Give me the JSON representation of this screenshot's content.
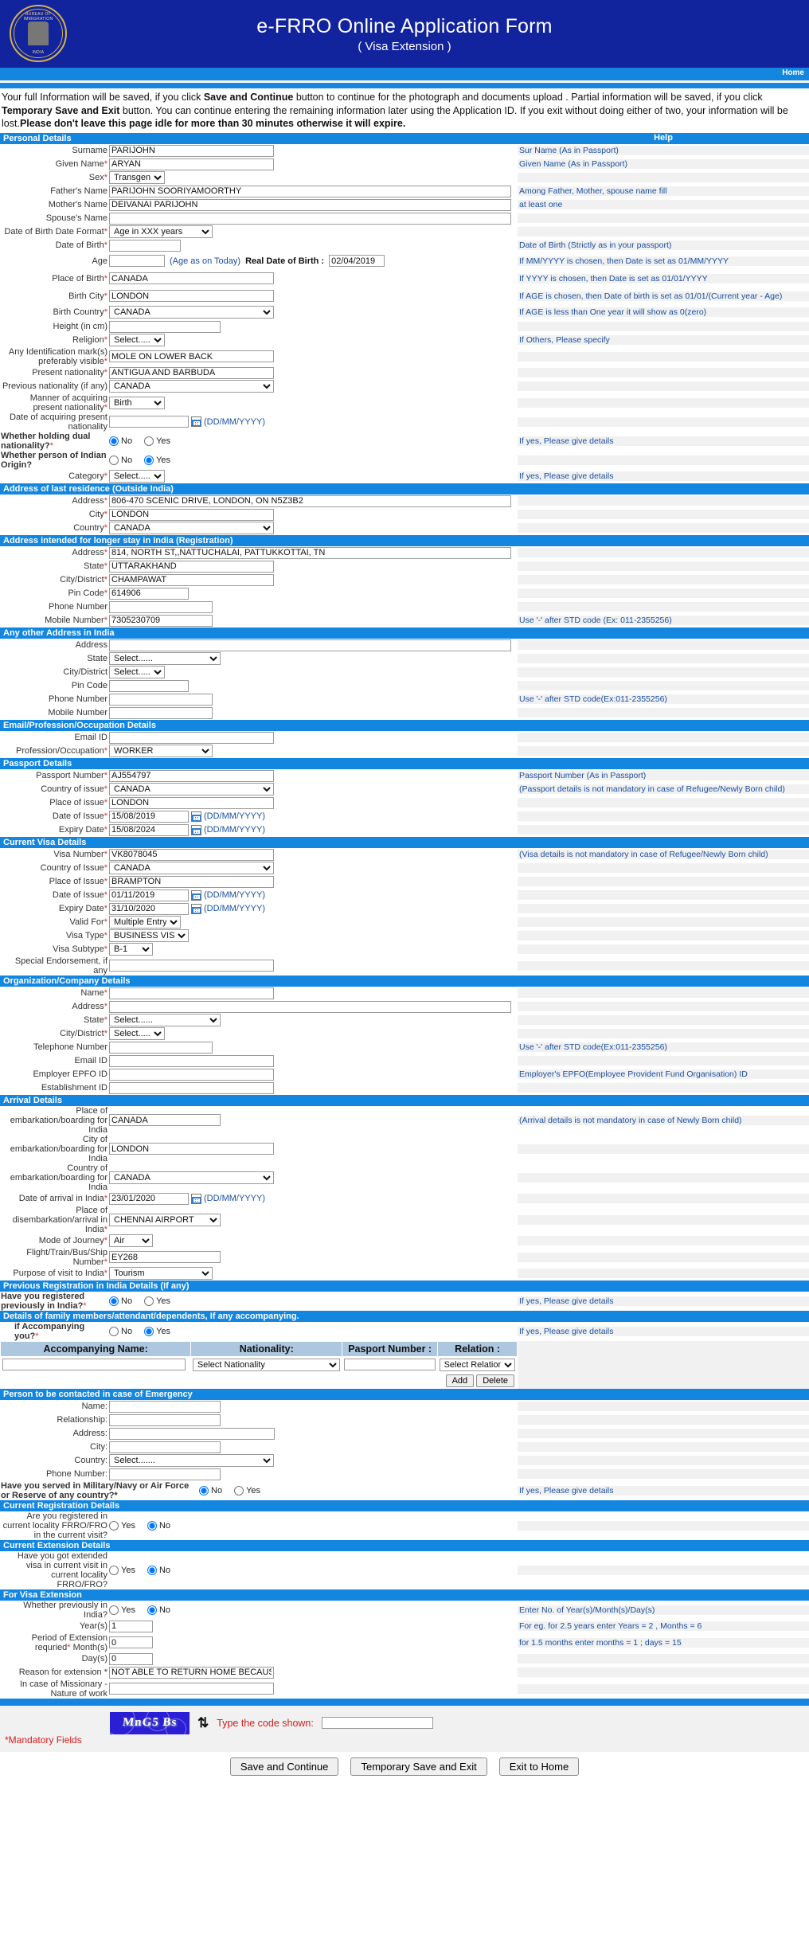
{
  "header": {
    "title": "e-FRRO Online Application Form",
    "subtitle": "( Visa Extension )",
    "emblem_top": "BUREAU OF IMMIGRATION",
    "emblem_bottom": "INDIA",
    "home_link": "Home"
  },
  "notice": {
    "p1": "Your full Information will be saved, if you click ",
    "b1": "Save and Continue",
    "p2": " button to continue for the photograph and documents upload . Partial information will be saved, if you click ",
    "b2": "Temporary Save and Exit",
    "p3": " button. You can continue entering the remaining information later using the Application ID. If you exit without doing either of two, your information will be lost.",
    "b3": "Please don't leave this page idle for more than 30 minutes otherwise it will expire."
  },
  "help_column_title": "Help",
  "sections": {
    "personal": "Personal Details",
    "last_residence": "Address of last residence (Outside India)",
    "longer_stay": "Address intended for longer stay in India (Registration)",
    "any_other": "Any other Address in India",
    "email_prof": "Email/Profession/Occupation Details",
    "passport": "Passport Details",
    "current_visa": "Current Visa Details",
    "organization": "Organization/Company Details",
    "arrival": "Arrival Details",
    "prev_registration": "Previous Registration in India Details (If any)",
    "family_details": "Details of family members/attendant/dependents, If any accompanying.",
    "emergency": "Person to be contacted in case of Emergency",
    "current_registration": "Current Registration Details",
    "current_extension": "Current Extension Details",
    "for_visa_extension": "For Visa Extension"
  },
  "personal": {
    "surname_label": "Surname",
    "surname_value": "PARIJOHN",
    "surname_help": "Sur Name (As in Passport)",
    "given_name_label": "Given Name",
    "given_name_value": "ARYAN",
    "given_name_help": "Given Name (As in Passport)",
    "sex_label": "Sex",
    "sex_value": "Transgender",
    "father_label": "Father's Name",
    "father_value": "PARIJOHN SOORIYAMOORTHY",
    "father_help": "Among Father, Mother, spouse name fill",
    "mother_label": "Mother's Name",
    "mother_value": "DEIVANAI PARIJOHN",
    "mother_help": "at least one",
    "spouse_label": "Spouse's Name",
    "spouse_value": "",
    "dob_format_label": "Date of Birth Date Format",
    "dob_format_value": "Age in XXX years",
    "dob_label": "Date of Birth",
    "dob_value": "",
    "dob_help": "Date of Birth (Strictly as in your passport)",
    "age_label": "Age",
    "age_value": "",
    "age_note": "(Age as on Today)",
    "real_dob_label": "Real Date of Birth :",
    "real_dob_value": "02/04/2019",
    "dob_help2": "If MM/YYYY is chosen, then Date is set as 01/MM/YYYY",
    "dob_help3": "If YYYY is chosen, then Date is set as 01/01/YYYY",
    "dob_help4": "If AGE is chosen, then Date of birth is set as 01/01/(Current year - Age)",
    "dob_help5": "If AGE is less than One year it will show as 0(zero)",
    "place_birth_label": "Place of Birth",
    "place_birth_value": "CANADA",
    "birth_city_label": "Birth City",
    "birth_city_value": "LONDON",
    "birth_country_label": "Birth Country",
    "birth_country_value": "CANADA",
    "height_label": "Height (in cm)",
    "height_value": "",
    "religion_label": "Religion",
    "religion_value": "Select......",
    "religion_help": "If Others, Please specify",
    "id_mark_label": "Any Identification mark(s) preferably visible",
    "id_mark_value": "MOLE ON LOWER BACK",
    "present_nat_label": "Present nationality",
    "present_nat_value": "ANTIGUA AND BARBUDA",
    "prev_nat_label": "Previous nationality (if any)",
    "prev_nat_value": "CANADA",
    "manner_label": "Manner of acquiring present nationality",
    "manner_value": "Birth",
    "acq_date_label": "Date of acquiring present nationality",
    "acq_date_value": "",
    "acq_date_fmt": "(DD/MM/YYYY)",
    "dual_label": "Whether holding dual nationality?",
    "dual_value": "No",
    "dual_help": "If yes, Please give details",
    "indian_origin_label": "Whether person of Indian Origin?",
    "indian_origin_value": "Yes",
    "category_label": "Category",
    "category_value": "Select......",
    "category_help": "If yes, Please give details",
    "yes": "Yes",
    "no": "No"
  },
  "last_residence": {
    "address_label": "Address",
    "address_value": "806-470 SCENIC DRIVE, LONDON, ON N5Z3B2",
    "city_label": "City",
    "city_value": "LONDON",
    "country_label": "Country",
    "country_value": "CANADA"
  },
  "longer_stay": {
    "address_label": "Address",
    "address_value": "814, NORTH ST,,NATTUCHALAI, PATTUKKOTTAI, TN",
    "state_label": "State",
    "state_value": "UTTARAKHAND",
    "city_label": "City/District",
    "city_value": "CHAMPAWAT",
    "pin_label": "Pin Code",
    "pin_value": "614906",
    "phone_label": "Phone Number",
    "phone_value": "",
    "mobile_label": "Mobile Number",
    "mobile_value": "7305230709",
    "phone_help": "Use '-' after STD code (Ex: 011-2355256)"
  },
  "any_other": {
    "address_label": "Address",
    "address_value": "",
    "state_label": "State",
    "state_value": "Select......",
    "city_label": "City/District",
    "city_value": "Select......",
    "pin_label": "Pin Code",
    "pin_value": "",
    "phone_label": "Phone Number",
    "phone_value": "",
    "mobile_label": "Mobile Number",
    "mobile_value": "",
    "phone_help": "Use '-' after STD code(Ex:011-2355256)"
  },
  "email_prof": {
    "email_label": "Email ID",
    "email_value": "",
    "profession_label": "Profession/Occupation",
    "profession_value": "WORKER"
  },
  "passport": {
    "number_label": "Passport Number",
    "number_value": "AJ554797",
    "number_help": "Passport Number (As in Passport)",
    "country_label": "Country of issue",
    "country_value": "CANADA",
    "country_help": "(Passport details is not mandatory in case of Refugee/Newly Born child)",
    "place_label": "Place of issue",
    "place_value": "LONDON",
    "doi_label": "Date of Issue",
    "doi_value": "15/08/2019",
    "expiry_label": "Expiry Date",
    "expiry_value": "15/08/2024",
    "date_fmt": "(DD/MM/YYYY)"
  },
  "current_visa": {
    "number_label": "Visa Number",
    "number_value": "VK8078045",
    "visa_help": "(Visa details is not mandatory in case of Refugee/Newly Born child)",
    "country_label": "Country of Issue",
    "country_value": "CANADA",
    "place_label": "Place of Issue",
    "place_value": "BRAMPTON",
    "doi_label": "Date of Issue",
    "doi_value": "01/11/2019",
    "expiry_label": "Expiry Date",
    "expiry_value": "31/10/2020",
    "valid_label": "Valid For",
    "valid_value": "Multiple Entry",
    "type_label": "Visa Type",
    "type_value": "BUSINESS VISA",
    "subtype_label": "Visa Subtype",
    "subtype_value": "B-1",
    "endorsement_label": "Special Endorsement, if any",
    "endorsement_value": "",
    "date_fmt": "(DD/MM/YYYY)"
  },
  "organization": {
    "name_label": "Name",
    "name_value": "",
    "address_label": "Address",
    "address_value": "",
    "state_label": "State",
    "state_value": "Select......",
    "city_label": "City/District",
    "city_value": "Select......",
    "telephone_label": "Telephone Number",
    "telephone_value": "",
    "telephone_help": "Use '-' after STD code(Ex:011-2355256)",
    "email_label": "Email ID",
    "email_value": "",
    "epfo_label": "Employer EPFO ID",
    "epfo_value": "",
    "epfo_help": "Employer's EPFO(Employee Provident Fund Organisation) ID",
    "estab_label": "Establishment ID",
    "estab_value": ""
  },
  "arrival": {
    "place_label": "Place of embarkation/boarding for India",
    "place_value": "CANADA",
    "arrival_help": "(Arrival details is not mandatory in case of Newly Born child)",
    "city_label": "City of embarkation/boarding for India",
    "city_value": "LONDON",
    "country_label": "Country of embarkation/boarding for India",
    "country_value": "CANADA",
    "date_label": "Date of arrival in India",
    "date_value": "23/01/2020",
    "date_fmt": "(DD/MM/YYYY)",
    "disembark_label": "Place of disembarkation/arrival in India",
    "disembark_value": "CHENNAI AIRPORT",
    "mode_label": "Mode of Journey",
    "mode_value": "Air",
    "flight_label": "Flight/Train/Bus/Ship Number",
    "flight_value": "EY268",
    "purpose_label": "Purpose of visit to India",
    "purpose_value": "Tourism"
  },
  "prev_registration": {
    "question_label": "Have you registered previously in India?",
    "value": "No",
    "help": "If yes, Please give details",
    "yes": "Yes",
    "no": "No"
  },
  "family": {
    "accompany_label": "if Accompanying you?",
    "accompany_value": "Yes",
    "help": "If yes, Please give details",
    "yes": "Yes",
    "no": "No",
    "columns": [
      "Accompanying Name:",
      "Nationality:",
      "Pasport Number :",
      "Relation :"
    ],
    "row": {
      "name": "",
      "nationality": "Select Nationality",
      "passport": "",
      "relation": "Select Relation"
    },
    "add_button": "Add",
    "delete_button": "Delete"
  },
  "emergency": {
    "name_label": "Name:",
    "name_value": "",
    "relationship_label": "Relationship:",
    "relationship_value": "",
    "address_label": "Address:",
    "address_value": "",
    "city_label": "City:",
    "city_value": "",
    "country_label": "Country:",
    "country_value": "Select.......",
    "phone_label": "Phone Number:",
    "phone_value": "",
    "military_label": "Have you served in Military/Navy or Air Force or Reserve of any country?*",
    "military_value": "No",
    "military_help": "If yes, Please give details",
    "yes": "Yes",
    "no": "No"
  },
  "current_registration": {
    "question_label": "Are you registered in current locality FRRO/FRO in the current visit?",
    "value": "No",
    "yes": "Yes",
    "no": "No"
  },
  "current_extension": {
    "question_label": "Have you got extended visa in current visit in current locality FRRO/FRO?",
    "value": "No",
    "yes": "Yes",
    "no": "No"
  },
  "visa_extension": {
    "prev_india_label": "Whether previously in India?",
    "prev_india_value": "No",
    "yes": "Yes",
    "no": "No",
    "period_label": "Period of Extension requried",
    "years_label": "Year(s)",
    "years_value": "1",
    "months_label": "Month(s)",
    "months_value": "0",
    "days_label": "Day(s)",
    "days_value": "0",
    "help1": "Enter No. of Year(s)/Month(s)/Day(s)",
    "help2": "For eg. for 2.5 years enter Years = 2 , Months = 6",
    "help3": "for 1.5 months enter months = 1 ; days = 15",
    "reason_label": "Reason for extension *",
    "reason_value": "NOT ABLE TO RETURN HOME BECAUSE OF TRAVEL RESTRICT",
    "missionary_label": "In case of Missionary - Nature of work",
    "missionary_value": ""
  },
  "captcha": {
    "code": "MnG5 Bs",
    "refresh_icon": "refresh-icon",
    "prompt": "Type the code shown:",
    "input_value": "",
    "mandatory_note": "*Mandatory Fields"
  },
  "buttons": {
    "save_continue": "Save and Continue",
    "temp_save": "Temporary Save and Exit",
    "exit_home": "Exit to Home"
  }
}
